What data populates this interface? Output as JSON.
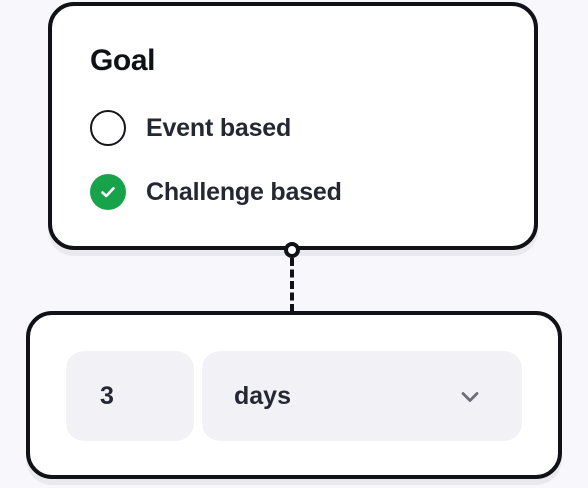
{
  "goal": {
    "title": "Goal",
    "options": [
      {
        "label": "Event based",
        "selected": false
      },
      {
        "label": "Challenge based",
        "selected": true
      }
    ]
  },
  "duration": {
    "amount": "3",
    "unit": "days"
  },
  "colors": {
    "selected_accent": "#16a34a",
    "border": "#111217",
    "field_bg": "#f2f2f6",
    "text": "#252733"
  },
  "icons": {
    "selected": "check-icon",
    "dropdown": "chevron-down-icon"
  }
}
